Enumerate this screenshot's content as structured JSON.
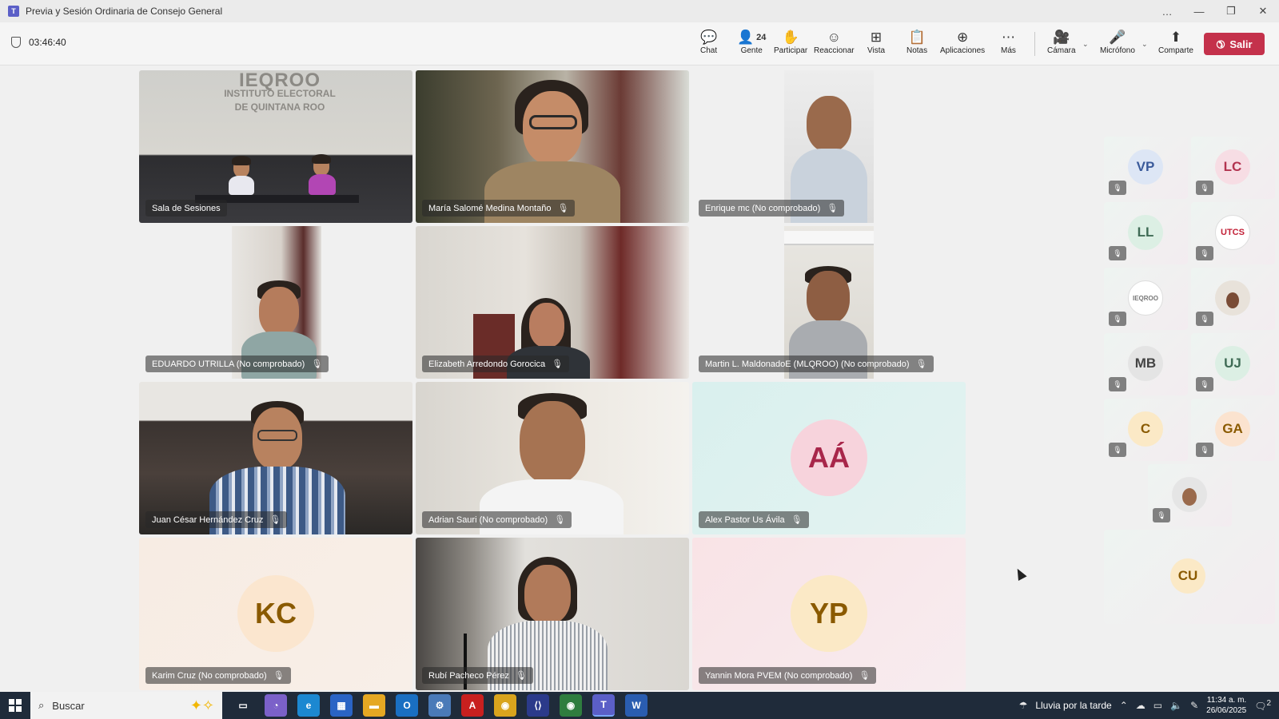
{
  "window": {
    "title": "Previa y Sesión Ordinaria de Consejo General",
    "controls": [
      "…",
      "—",
      "❐",
      "✕"
    ]
  },
  "meeting": {
    "timer": "03:46:40"
  },
  "toolbar": {
    "chat": "Chat",
    "people": "Gente",
    "people_count": "24",
    "raise": "Participar",
    "react": "Reaccionar",
    "view": "Vista",
    "notes": "Notas",
    "apps": "Aplicaciones",
    "more": "Más",
    "camera": "Cámara",
    "mic": "Micrófono",
    "share": "Comparte",
    "leave": "Salir"
  },
  "tiles": [
    {
      "name": "Sala de Sesiones",
      "muted": false,
      "kind": "video",
      "sign_line1": "IEQROO",
      "sign_line2": "INSTITUTO ELECTORAL",
      "sign_line3": "DE QUINTANA ROO"
    },
    {
      "name": "María Salomé Medina Montaño",
      "muted": true,
      "kind": "video"
    },
    {
      "name": "Enrique mc (No comprobado)",
      "muted": true,
      "kind": "video"
    },
    {
      "name": "EDUARDO UTRILLA (No comprobado)",
      "muted": true,
      "kind": "video"
    },
    {
      "name": "Elizabeth Arredondo Gorocica",
      "muted": true,
      "kind": "video"
    },
    {
      "name": "Martin L. MaldonadoE (MLQROO) (No comprobado)",
      "muted": true,
      "kind": "video"
    },
    {
      "name": "Juan César Hernández Cruz",
      "muted": true,
      "kind": "video"
    },
    {
      "name": "Adrian Sauri (No comprobado)",
      "muted": true,
      "kind": "video"
    },
    {
      "name": "Alex Pastor Us Ávila",
      "muted": true,
      "kind": "avatar",
      "initials": "AÁ"
    },
    {
      "name": "Karim Cruz (No comprobado)",
      "muted": true,
      "kind": "avatar",
      "initials": "KC"
    },
    {
      "name": "Rubí Pacheco Pérez",
      "muted": true,
      "kind": "video"
    },
    {
      "name": "Yannin Mora PVEM (No comprobado)",
      "muted": true,
      "kind": "avatar",
      "initials": "YP"
    }
  ],
  "side_participants": [
    {
      "initials": "VP",
      "color": "#3a5a9a",
      "bg": "#dde6f5"
    },
    {
      "initials": "LC",
      "color": "#b2334f",
      "bg": "#f7dde4"
    },
    {
      "initials": "LL",
      "color": "#3f6b55",
      "bg": "#dcefe4"
    },
    {
      "initials": "UTCS",
      "color": "#c21f36",
      "bg": "#ffffff"
    },
    {
      "initials": "IEQROO",
      "color": "#777777",
      "bg": "#ffffff"
    },
    {
      "initials": "",
      "color": "#555555",
      "bg": "#e8e2da"
    },
    {
      "initials": "MB",
      "color": "#444444",
      "bg": "#e4e4e4"
    },
    {
      "initials": "UJ",
      "color": "#3f6b55",
      "bg": "#dcefe4"
    },
    {
      "initials": "C",
      "color": "#8a5a00",
      "bg": "#fbe9c6"
    },
    {
      "initials": "GA",
      "color": "#8a5a00",
      "bg": "#fbe3cf"
    },
    {
      "initials": "",
      "color": "#555555",
      "bg": "#e5e5e5"
    }
  ],
  "side_large": {
    "initials": "CU",
    "color": "#8a5a00",
    "bg": "#fbe9c6"
  },
  "taskbar": {
    "search_placeholder": "Buscar",
    "weather": "Lluvia por la tarde",
    "time": "11:34 a. m.",
    "date": "26/06/2025",
    "notif_count": "2"
  },
  "colors": {
    "accent": "#5b5fc7",
    "leave": "#c4314b",
    "taskbar": "#1f2b3a"
  }
}
